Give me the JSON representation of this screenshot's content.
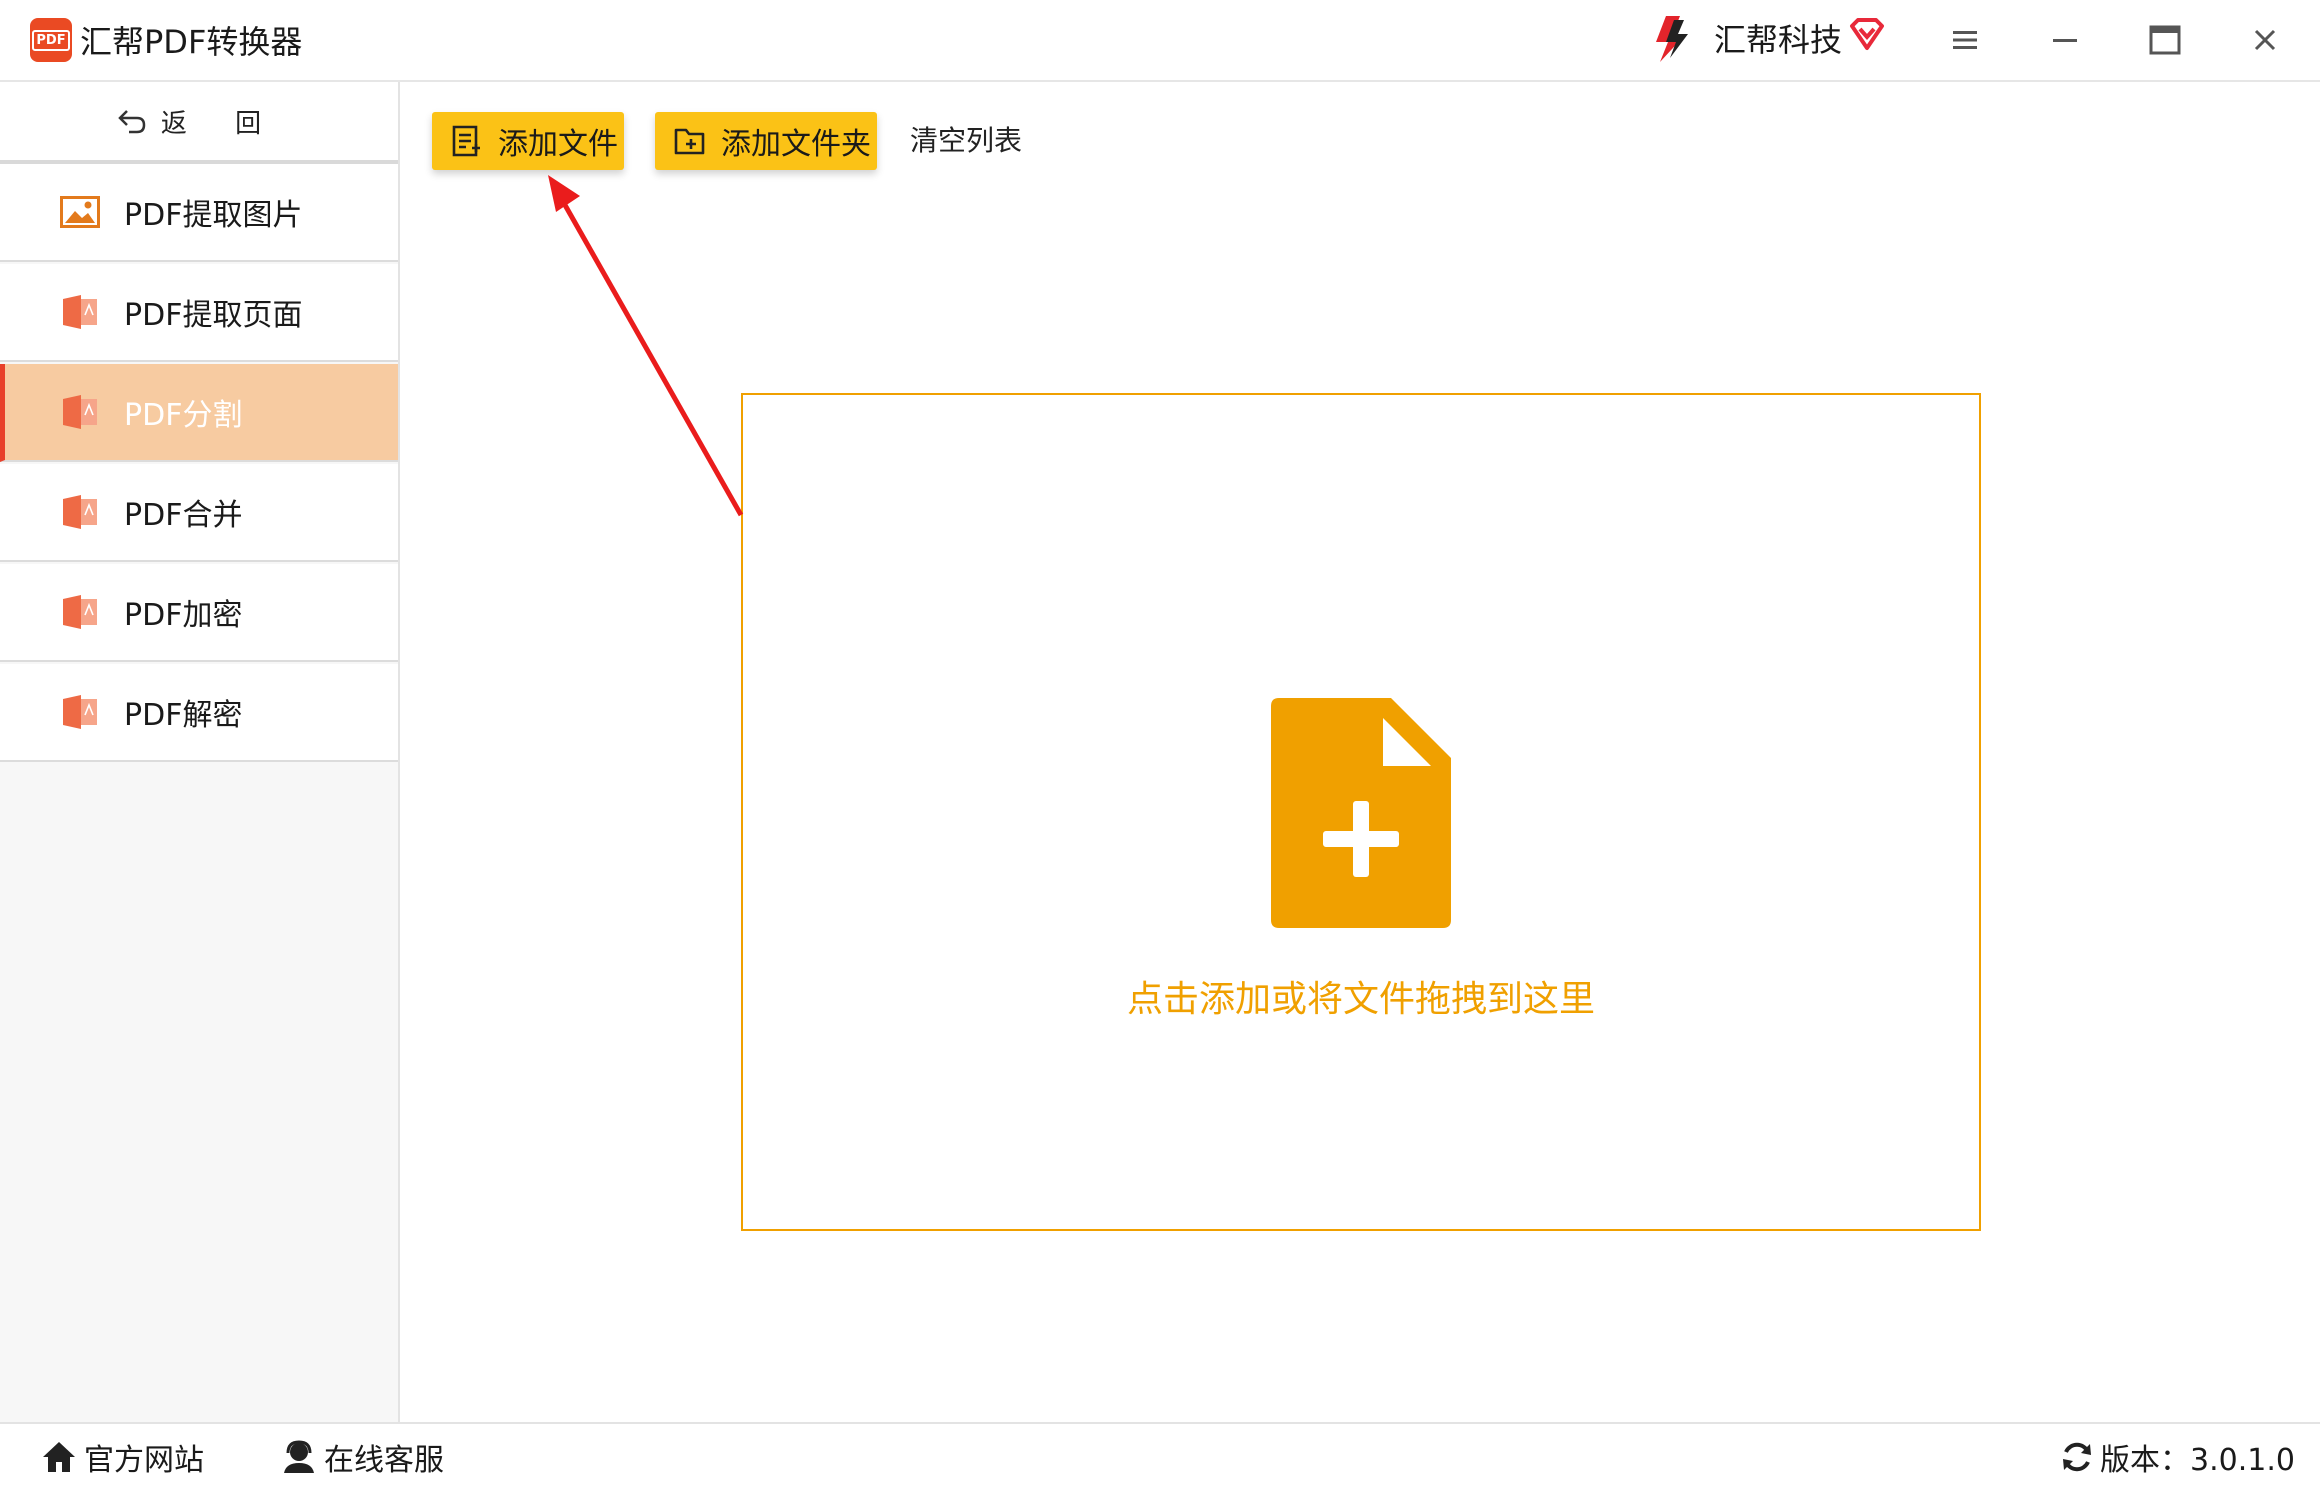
{
  "app": {
    "title": "汇帮PDF转换器",
    "logo_text": "PDF",
    "brand_name": "汇帮科技",
    "accent_color": "#fbc216",
    "drop_color": "#f0a000",
    "active_color": "#f7cba1"
  },
  "window_controls": {
    "menu_icon": "hamburger-icon",
    "minimize_icon": "minimize-icon",
    "maximize_icon": "maximize-icon",
    "close_icon": "close-icon"
  },
  "sidebar": {
    "back_label": "返 回",
    "items": [
      {
        "label": "PDF提取图片",
        "icon": "image-icon",
        "active": false
      },
      {
        "label": "PDF提取页面",
        "icon": "pdf-file-icon",
        "active": false
      },
      {
        "label": "PDF分割",
        "icon": "pdf-file-icon",
        "active": true
      },
      {
        "label": "PDF合并",
        "icon": "pdf-file-icon",
        "active": false
      },
      {
        "label": "PDF加密",
        "icon": "pdf-file-icon",
        "active": false
      },
      {
        "label": "PDF解密",
        "icon": "pdf-file-icon",
        "active": false
      }
    ]
  },
  "toolbar": {
    "add_file_label": "添加文件",
    "add_folder_label": "添加文件夹",
    "clear_label": "清空列表"
  },
  "dropzone": {
    "text": "点击添加或将文件拖拽到这里",
    "icon": "add-file-icon"
  },
  "footer": {
    "website_label": "官方网站",
    "support_label": "在线客服",
    "version_label": "版本：3.0.1.0"
  }
}
